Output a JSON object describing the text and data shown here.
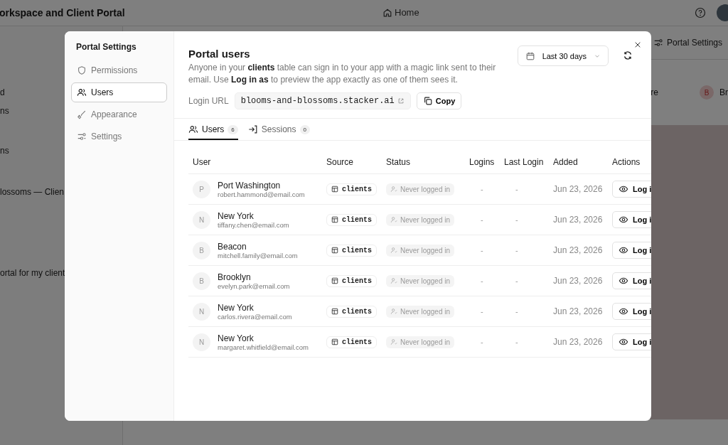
{
  "app": {
    "title": "orkspace and Client Portal",
    "home": "Home",
    "sidebar_fragments": [
      "d",
      "ns",
      "ns",
      "lossoms — Clien",
      "ortal for my client"
    ],
    "portal_settings": "Portal Settings",
    "filter_fragment": "re",
    "user_initial": "B",
    "user_fragment": "Br"
  },
  "modal": {
    "nav_title": "Portal Settings",
    "nav": [
      {
        "label": "Permissions",
        "selected": false
      },
      {
        "label": "Users",
        "selected": true
      },
      {
        "label": "Appearance",
        "selected": false
      },
      {
        "label": "Settings",
        "selected": false
      }
    ],
    "title": "Portal users",
    "description": "Anyone in your **clients** table can sign in to your app with a magic link sent to their email. Use **Log in as** to preview the app exactly as one of them sees it.",
    "login_url_label": "Login URL",
    "login_url": "blooms-and-blossoms.stacker.ai",
    "copy": "Copy",
    "date_range": "Last 30 days",
    "tabs": [
      {
        "label": "Users",
        "count": "6",
        "selected": true
      },
      {
        "label": "Sessions",
        "count": "0",
        "selected": false
      }
    ],
    "columns": [
      "User",
      "Source",
      "Status",
      "Logins",
      "Last Login",
      "Added",
      "Actions"
    ],
    "rows": [
      {
        "initial": "P",
        "name": "Port Washington",
        "email": "robert.hammond@email.com",
        "source": "clients",
        "status": "Never logged in",
        "logins": "-",
        "last_login": "-",
        "added": "Jun 23, 2026",
        "action": "Log i"
      },
      {
        "initial": "N",
        "name": "New York",
        "email": "tiffany.chen@email.com",
        "source": "clients",
        "status": "Never logged in",
        "logins": "-",
        "last_login": "-",
        "added": "Jun 23, 2026",
        "action": "Log i"
      },
      {
        "initial": "B",
        "name": "Beacon",
        "email": "mitchell.family@email.com",
        "source": "clients",
        "status": "Never logged in",
        "logins": "-",
        "last_login": "-",
        "added": "Jun 23, 2026",
        "action": "Log i"
      },
      {
        "initial": "B",
        "name": "Brooklyn",
        "email": "evelyn.park@email.com",
        "source": "clients",
        "status": "Never logged in",
        "logins": "-",
        "last_login": "-",
        "added": "Jun 23, 2026",
        "action": "Log i"
      },
      {
        "initial": "N",
        "name": "New York",
        "email": "carlos.rivera@email.com",
        "source": "clients",
        "status": "Never logged in",
        "logins": "-",
        "last_login": "-",
        "added": "Jun 23, 2026",
        "action": "Log i"
      },
      {
        "initial": "N",
        "name": "New York",
        "email": "margaret.whitfield@email.com",
        "source": "clients",
        "status": "Never logged in",
        "logins": "-",
        "last_login": "-",
        "added": "Jun 23, 2026",
        "action": "Log i"
      }
    ]
  }
}
